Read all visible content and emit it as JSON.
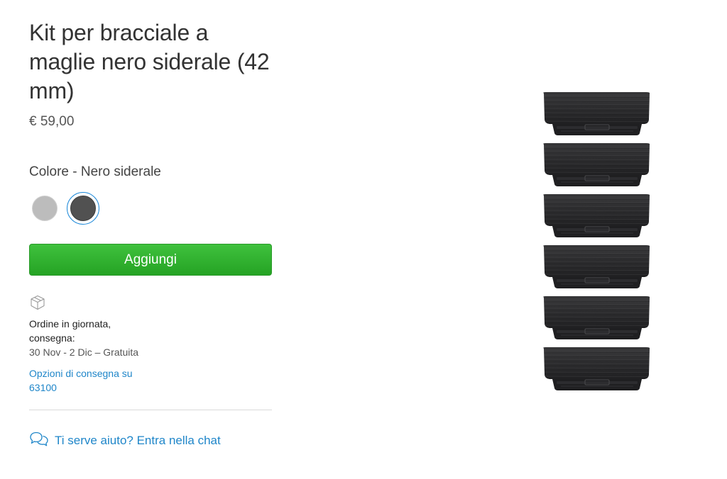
{
  "product": {
    "title": "Kit per bracciale a maglie nero siderale (42 mm)",
    "price": "€ 59,00"
  },
  "color": {
    "label": "Colore - Nero siderale",
    "options": [
      {
        "name": "silver",
        "hex": "#bcbcbc"
      },
      {
        "name": "space-black",
        "hex": "#515151",
        "selected": true
      }
    ]
  },
  "actions": {
    "add_label": "Aggiungi"
  },
  "shipping": {
    "icon": "box-icon",
    "line1": "Ordine in giornata,",
    "line2": "consegna:",
    "dates": "30 Nov - 2 Dic – Gratuita",
    "options_link": "Opzioni di consegna su 63100"
  },
  "help": {
    "icon": "chat-bubbles-icon",
    "label": "Ti serve aiuto? Entra nella chat"
  },
  "colors": {
    "accent": "#1f86c9",
    "button": "#2fb52e"
  }
}
